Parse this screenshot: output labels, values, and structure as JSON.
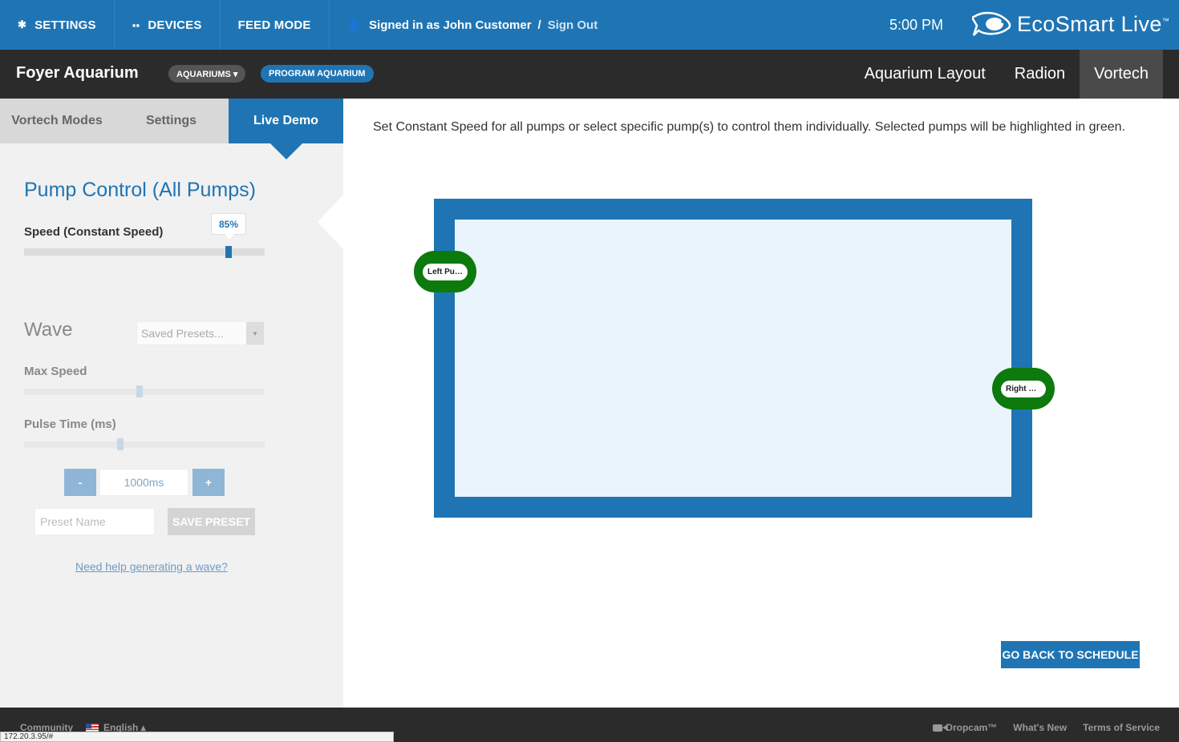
{
  "topbar": {
    "settings": "SETTINGS",
    "devices": "DEVICES",
    "feed_mode": "FEED MODE",
    "signed_in_prefix": "Signed in as John Customer",
    "separator": "/",
    "sign_out": "Sign Out",
    "time": "5:00 PM",
    "brand": "EcoSmart Live",
    "brand_tm": "™"
  },
  "subbar": {
    "aquarium_title": "Foyer Aquarium",
    "aquariums_label": "AQUARIUMS ▾",
    "program_label": "PROGRAM AQUARIUM",
    "tabs": [
      "Aquarium Layout",
      "Radion",
      "Vortech"
    ]
  },
  "left_tabs": [
    "Vortech Modes",
    "Settings",
    "Live Demo"
  ],
  "pump_control": {
    "title": "Pump Control (All Pumps)",
    "speed_label": "Speed (Constant Speed)",
    "speed_value": "85%",
    "speed_fraction": 0.85
  },
  "wave": {
    "title": "Wave",
    "presets_placeholder": "Saved Presets...",
    "max_speed_label": "Max Speed",
    "max_speed_fraction": 0.48,
    "pulse_label": "Pulse Time (ms)",
    "pulse_fraction": 0.4,
    "minus": "-",
    "plus": "+",
    "pulse_value": "1000ms",
    "preset_name_placeholder": "Preset Name",
    "save_preset": "SAVE PRESET",
    "help_link": "Need help generating a wave?"
  },
  "main": {
    "instruction": "Set Constant Speed for all pumps or select specific pump(s) to control them individually. Selected pumps will be highlighted in green.",
    "left_pump": "Left Pump",
    "right_pump": "Right Pump",
    "back_button": "GO BACK TO SCHEDULE"
  },
  "footer": {
    "community": "Community",
    "language": "English ▴",
    "dropcam": "Dropcam™",
    "whats_new": "What's New",
    "terms": "Terms of Service"
  },
  "status_url": "172.20.3.95/#",
  "colors": {
    "brand_blue": "#1f75b4",
    "dark_bar": "#2b2b2b",
    "pump_green": "#0c7a0c",
    "water": "#e9f4fc"
  }
}
